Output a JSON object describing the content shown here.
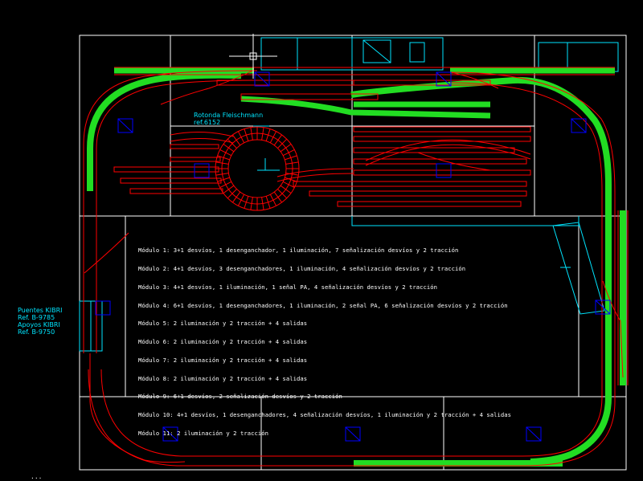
{
  "labels": {
    "rotonda_title": "Rotonda Fleischmann",
    "rotonda_ref": "ref.6152",
    "puentes_title": "Puentes KIBRI",
    "puentes_ref1": "Ref. B-9785",
    "puentes_apoyos": "Apoyos KIBRI",
    "puentes_ref2": "Ref. B-9750"
  },
  "module_notes": [
    "Módulo 1: 3+1 desvíos, 1 desenganchador, 1 iluminación, 7 señalización desvíos y 2 tracción",
    "Módulo 2: 4+1 desvíos, 3 desenganchadores, 1 iluminación, 4 señalización desvíos y 2 tracción",
    "Módulo 3: 4+1 desvíos, 1 iluminación, 1 señal PA, 4 señalización desvíos y 2 tracción",
    "Módulo 4: 6+1 desvíos, 1 desenganchadores, 1 iluminación, 2 señal PA, 6 señalización desvíos y 2 tracción",
    "Módulo 5: 2 iluminación y 2 tracción + 4 salidas",
    "Módulo 6: 2 iluminación y 2 tracción + 4 salidas",
    "Módulo 7: 2 iluminación y 2 tracción + 4 salidas",
    "Módulo 8: 2 iluminación y 2 tracción + 4 salidas",
    "Módulo 9: 6+1 desvíos, 2 señalización desvíos y 2 tracción",
    "Módulo 10: 4+1 desvíos, 1 desenganchadores, 4 señalización desvíos, 1 iluminación y 2 tracción + 4 salidas",
    "Módulo 11: 2 iluminación y 2 tracción"
  ],
  "status_text": "...",
  "colors": {
    "background": "#000000",
    "frame": "#ffffff",
    "rail": "#ff0000",
    "track_fill": "#22dd22",
    "annotation": "#00e5ff",
    "module_marker": "#0000ff",
    "text": "#ffffff"
  },
  "icons": [
    "crosshair-cursor"
  ]
}
